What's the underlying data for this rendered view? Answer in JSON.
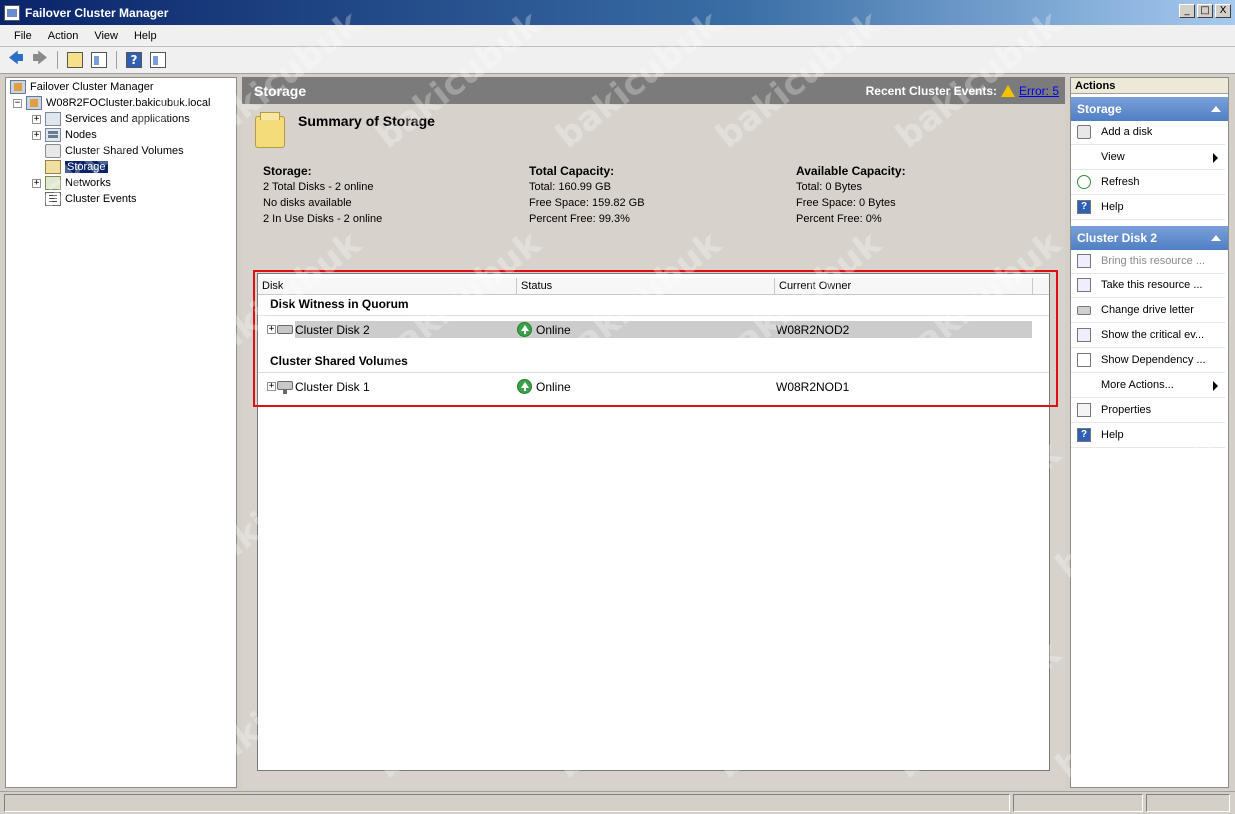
{
  "window": {
    "title": "Failover Cluster Manager",
    "minimize": "_",
    "maximize": "□",
    "close": "X"
  },
  "menu": [
    "File",
    "Action",
    "View",
    "Help"
  ],
  "tree": {
    "root": "Failover Cluster Manager",
    "cluster": "W08R2FOCluster.bakicubuk.local",
    "items": [
      "Services and applications",
      "Nodes",
      "Cluster Shared Volumes",
      "Storage",
      "Networks",
      "Cluster Events"
    ]
  },
  "center": {
    "header_title": "Storage",
    "recent_events_label": "Recent Cluster Events:",
    "error_link": "Error: 5",
    "summary_title": "Summary of Storage",
    "storage": {
      "head": "Storage:",
      "lines": [
        "2 Total Disks - 2 online",
        "No disks available",
        "2 In Use Disks - 2 online"
      ]
    },
    "capacity": {
      "head": "Total Capacity:",
      "lines": [
        "Total: 160.99 GB",
        "Free Space: 159.82 GB",
        "Percent Free: 99.3%"
      ]
    },
    "available": {
      "head": "Available Capacity:",
      "lines": [
        "Total: 0 Bytes",
        "Free Space: 0 Bytes",
        "Percent Free: 0%"
      ]
    },
    "columns": [
      "Disk",
      "Status",
      "Current Owner"
    ],
    "groups": [
      {
        "title": "Disk Witness in Quorum",
        "disk": "Cluster Disk 2",
        "status": "Online",
        "owner": "W08R2NOD2"
      },
      {
        "title": "Cluster Shared Volumes",
        "disk": "Cluster Disk 1",
        "status": "Online",
        "owner": "W08R2NOD1"
      }
    ]
  },
  "actions": {
    "title": "Actions",
    "section1": "Storage",
    "section1_items": [
      "Add a disk",
      "View",
      "Refresh",
      "Help"
    ],
    "section2": "Cluster Disk 2",
    "section2_items": [
      "Bring this resource ...",
      "Take this resource ...",
      "Change drive letter",
      "Show the critical ev...",
      "Show Dependency ...",
      "More Actions...",
      "Properties",
      "Help"
    ]
  },
  "watermark": "bakicubuk"
}
